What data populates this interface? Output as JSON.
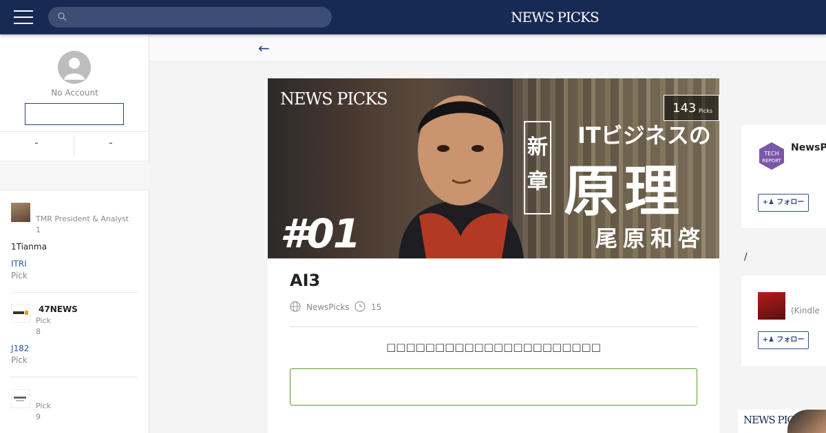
{
  "header": {
    "logo_left": "NEWS",
    "logo_right": "PICKS",
    "search_placeholder": ""
  },
  "sidebar": {
    "account_label": "No Account",
    "stat_left": "-",
    "stat_right": "-",
    "feed": [
      {
        "meta1": "TMR President & Analyst",
        "meta2": "1",
        "body": "1Tianma",
        "link": "ITRI",
        "pick": "Pick"
      },
      {
        "title": "47NEWS",
        "meta1": "Pick",
        "meta2": "8",
        "link": "J182",
        "pick": "Pick"
      },
      {
        "meta1": "Pick",
        "meta2": "9"
      }
    ]
  },
  "article": {
    "hero": {
      "logo": "NEWS PICKS",
      "episode": "#01",
      "tag": "新章",
      "line1": "ITビジネスの",
      "line2": "原理",
      "line3": "尾原和啓"
    },
    "picks_count": "143",
    "picks_label": "Picks",
    "title": "AI3",
    "source": "NewsPicks",
    "time": "15",
    "notice": "□□□□□□□□□□□□□□□□□□□□□□",
    "colors": {
      "header": "#172a54",
      "accent": "#2b4a8a",
      "green_border": "#5a9a2a"
    }
  },
  "right": {
    "card1_name": "NewsP",
    "card1_follow": "フォロー",
    "slash": "/",
    "card2_name": "(Kindle",
    "card2_follow": "フォロー",
    "logo": "NEWS PICKS"
  }
}
